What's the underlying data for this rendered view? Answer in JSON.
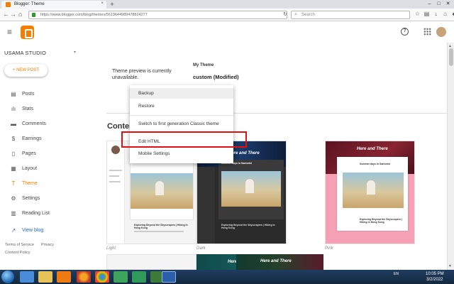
{
  "browser": {
    "tab_title": "Blogger: Theme",
    "tab_close": "×",
    "new_tab": "+",
    "url": "https://www.blogger.com/blog/themes/5613644989478824277",
    "search_placeholder": "Search",
    "win_min": "–",
    "win_max": "□",
    "win_close": "✕",
    "back": "←",
    "forward": "→",
    "reload": "↻",
    "home": "⌂"
  },
  "header": {
    "menu_icon": "≡",
    "help_icon": "?"
  },
  "sidebar": {
    "blog_name": "USAMA STUDIO",
    "caret": "▾",
    "new_post": "+ NEW POST",
    "items": [
      {
        "label": "Posts",
        "icon": "▤"
      },
      {
        "label": "Stats",
        "icon": "ılı"
      },
      {
        "label": "Comments",
        "icon": "▬"
      },
      {
        "label": "Earnings",
        "icon": "$"
      },
      {
        "label": "Pages",
        "icon": "▯"
      },
      {
        "label": "Layout",
        "icon": "▦"
      },
      {
        "label": "Theme",
        "icon": "T"
      },
      {
        "label": "Settings",
        "icon": "⚙"
      },
      {
        "label": "Reading List",
        "icon": "▥"
      }
    ],
    "view_blog": "View blog",
    "view_icon": "↗",
    "footer": {
      "terms": "Terms of Service",
      "privacy": "Privacy",
      "policy": "Content Policy"
    }
  },
  "main": {
    "preview_message": "Theme preview is currently unavailable.",
    "my_theme_label": "My Theme",
    "my_theme_name": "custom (Modified)",
    "content_heading": "Conten",
    "themes": [
      {
        "label": "Light"
      },
      {
        "label": "Dark",
        "title": "Here and There",
        "post_title": "Summer days in Santorini"
      },
      {
        "label": "Pink",
        "title": "Here and There",
        "post_title": "Summer days in Santorini"
      }
    ],
    "post_heading": "Exploring Beyond the Skyscrapers | Hiking in Hong Kong",
    "row2_titles": [
      "Here and There",
      "Here and There"
    ]
  },
  "menu": {
    "items": [
      "Backup",
      "Restore",
      "Switch to first generation Classic theme",
      "Edit HTML",
      "Mobile Settings"
    ]
  },
  "taskbar": {
    "lang": "EN",
    "time": "10:05 PM",
    "date": "3/2/2022"
  },
  "colors": {
    "accent": "#f57d00",
    "link": "#2a6ab8",
    "highlight": "#e01010"
  }
}
